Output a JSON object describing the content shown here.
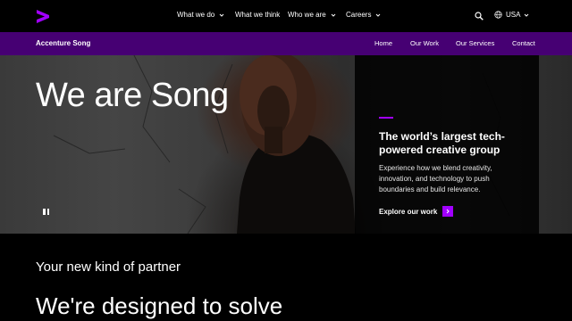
{
  "brand": {
    "logo_icon": "accenture-chevron-icon",
    "accent_color": "#a100ff",
    "bar_color": "#460073"
  },
  "topnav": {
    "items": [
      {
        "label": "What we do",
        "has_dropdown": true
      },
      {
        "label": "What we think",
        "has_dropdown": false
      },
      {
        "label": "Who we are",
        "has_dropdown": true
      },
      {
        "label": "Careers",
        "has_dropdown": true
      }
    ],
    "search_icon": "search-icon",
    "region": "USA"
  },
  "subnav": {
    "title": "Accenture Song",
    "links": [
      "Home",
      "Our Work",
      "Our Services",
      "Contact"
    ]
  },
  "hero": {
    "title": "We are Song",
    "panel": {
      "heading": "The world’s largest tech-powered creative group",
      "text": "Experience how we blend creativity, innovation, and technology to push boundaries and build relevance.",
      "cta_label": "Explore our work"
    }
  },
  "section": {
    "sub_heading": "Your new kind of partner",
    "heading": "We're designed to solve"
  }
}
